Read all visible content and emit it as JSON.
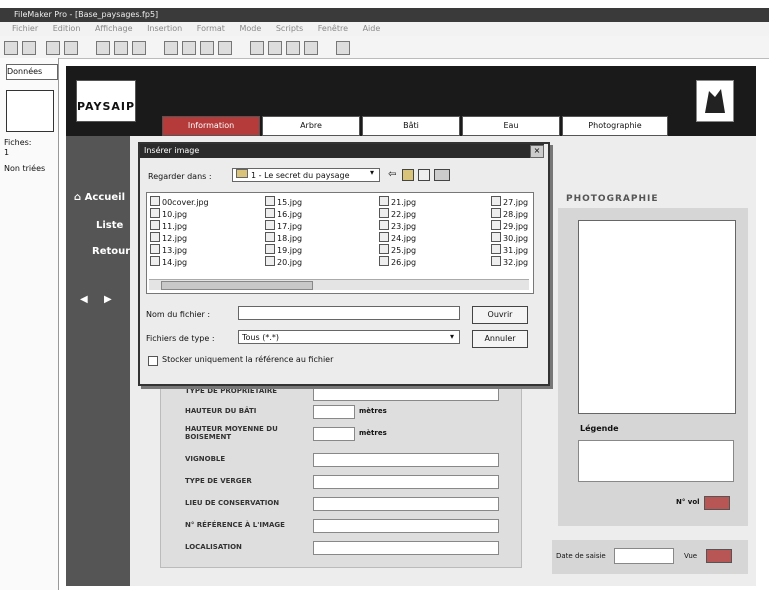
{
  "window": {
    "title": "FileMaker Pro - [Base_paysages.fp5]"
  },
  "menu": [
    "Fichier",
    "Edition",
    "Affichage",
    "Insertion",
    "Format",
    "Mode",
    "Scripts",
    "Fenêtre",
    "Aide"
  ],
  "nav": {
    "mode": "Données",
    "records_label": "Fiches:",
    "records_value": "1",
    "unsorted_label": "Non triées"
  },
  "app": {
    "logo_text": "PAYSAIP"
  },
  "tabs": [
    "Information",
    "Arbre",
    "Bâti",
    "Eau",
    "Photographie"
  ],
  "sidebar": {
    "accueil": "Accueil",
    "liste": "Liste",
    "retour": "Retour"
  },
  "form": {
    "labels": [
      "Type de propriétaire",
      "Hauteur du bâti",
      "Hauteur moyenne du boisement",
      "Vignoble",
      "Type de verger",
      "Lieu de conservation",
      "N° référence à l'image",
      "Localisation"
    ],
    "unit": "mètres"
  },
  "photo": {
    "title": "PHOTOGRAPHIE",
    "legend_label": "Légende",
    "num_label": "N° vol",
    "date_label": "Date de saisie",
    "view_label": "Vue"
  },
  "dialog": {
    "title": "Insérer image",
    "look_in_label": "Regarder dans :",
    "look_in_value": "1 - Le secret du paysage",
    "files": [
      [
        "00cover.jpg",
        "10.jpg",
        "11.jpg",
        "12.jpg",
        "13.jpg",
        "14.jpg"
      ],
      [
        "15.jpg",
        "16.jpg",
        "17.jpg",
        "18.jpg",
        "19.jpg",
        "20.jpg"
      ],
      [
        "21.jpg",
        "22.jpg",
        "23.jpg",
        "24.jpg",
        "25.jpg",
        "26.jpg"
      ],
      [
        "27.jpg",
        "28.jpg",
        "29.jpg",
        "30.jpg",
        "31.jpg",
        "32.jpg"
      ]
    ],
    "filename_label": "Nom du fichier :",
    "filetype_label": "Fichiers de type :",
    "filetype_value": "Tous (*.*)",
    "open_button": "Ouvrir",
    "cancel_button": "Annuler",
    "checkbox_label": "Stocker uniquement la référence au fichier"
  }
}
